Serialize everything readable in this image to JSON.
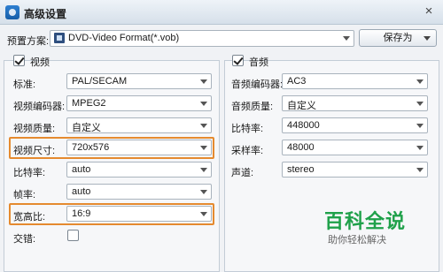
{
  "window": {
    "title": "高级设置",
    "close_glyph": "×"
  },
  "preset": {
    "label": "预置方案:",
    "value": "DVD-Video Format(*.vob)",
    "save_as": "保存为"
  },
  "video": {
    "section_label": "视频",
    "checked": true,
    "standard": {
      "label": "标准:",
      "value": "PAL/SECAM"
    },
    "encoder": {
      "label": "视频编码器:",
      "value": "MPEG2"
    },
    "quality": {
      "label": "视频质量:",
      "value": "自定义"
    },
    "size": {
      "label": "视频尺寸:",
      "value": "720x576"
    },
    "bitrate": {
      "label": "比特率:",
      "value": "auto"
    },
    "framerate": {
      "label": "帧率:",
      "value": "auto"
    },
    "aspect": {
      "label": "宽高比:",
      "value": "16:9"
    },
    "interlace": {
      "label": "交错:",
      "checked": false
    }
  },
  "audio": {
    "section_label": "音频",
    "checked": true,
    "encoder": {
      "label": "音频编码器:",
      "value": "AC3"
    },
    "quality": {
      "label": "音频质量:",
      "value": "自定义"
    },
    "bitrate": {
      "label": "比特率:",
      "value": "448000"
    },
    "samplerate": {
      "label": "采样率:",
      "value": "48000"
    },
    "channels": {
      "label": "声道:",
      "value": "stereo"
    }
  },
  "watermark": {
    "title": "百科全说",
    "subtitle": "助你轻松解决"
  },
  "colors": {
    "highlight": "#e58a2f",
    "watermark": "#1fa14a"
  }
}
